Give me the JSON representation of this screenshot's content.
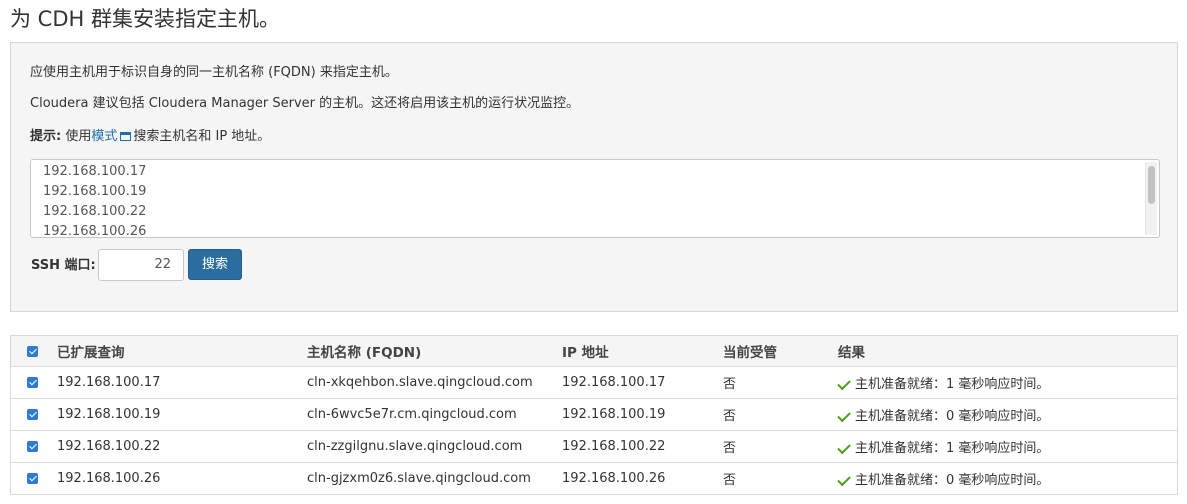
{
  "page": {
    "title": "为 CDH 群集安装指定主机。"
  },
  "search_panel": {
    "instruction": "应使用主机用于标识自身的同一主机名称 (FQDN) 来指定主机。",
    "recommendation": "Cloudera 建议包括 Cloudera Manager Server 的主机。这还将启用该主机的运行状况监控。",
    "hint_prefix": "提示:",
    "hint_use": " 使用",
    "hint_mode_link": "模式",
    "hint_suffix": "搜索主机名和 IP 地址。",
    "hosts_lines": [
      "192.168.100.17",
      "192.168.100.19",
      "192.168.100.22",
      "192.168.100.26"
    ],
    "ssh_label": "SSH 端口:",
    "ssh_port": "22",
    "search_button": "搜索"
  },
  "results": {
    "headers": {
      "expanded_query": "已扩展查询",
      "hostname": "主机名称 (FQDN)",
      "ip": "IP 地址",
      "managed": "当前受管",
      "result": "结果"
    },
    "rows": [
      {
        "checked": true,
        "expanded_query": "192.168.100.17",
        "hostname": "cln-xkqehbon.slave.qingcloud.com",
        "ip": "192.168.100.17",
        "managed": "否",
        "result": "主机准备就绪：1 毫秒响应时间。"
      },
      {
        "checked": true,
        "expanded_query": "192.168.100.19",
        "hostname": "cln-6wvc5e7r.cm.qingcloud.com",
        "ip": "192.168.100.19",
        "managed": "否",
        "result": "主机准备就绪：0 毫秒响应时间。"
      },
      {
        "checked": true,
        "expanded_query": "192.168.100.22",
        "hostname": "cln-zzgilgnu.slave.qingcloud.com",
        "ip": "192.168.100.22",
        "managed": "否",
        "result": "主机准备就绪：1 毫秒响应时间。"
      },
      {
        "checked": true,
        "expanded_query": "192.168.100.26",
        "hostname": "cln-gjzxm0z6.slave.qingcloud.com",
        "ip": "192.168.100.26",
        "managed": "否",
        "result": "主机准备就绪：0 毫秒响应时间。"
      }
    ]
  },
  "colors": {
    "accent": "#2a6d9e",
    "link": "#1f6fa8",
    "checkbox": "#2f7bd1",
    "success": "#45a11e",
    "panel_bg": "#f5f5f5"
  }
}
